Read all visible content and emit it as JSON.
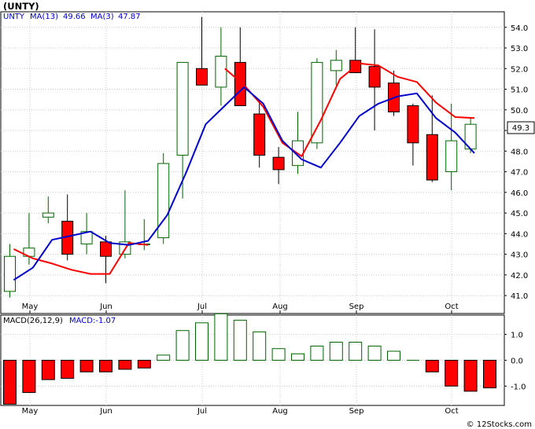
{
  "header": {
    "title": "(UNTY)",
    "legend_prefix": "UNTY",
    "ma13_label": "MA(13)",
    "ma13_value": "49.66",
    "ma3_label": "MA(3)",
    "ma3_value": "47.87",
    "last_price_badge": "49.3",
    "macd_label": "MACD(26,12,9)",
    "macd_value_label": "MACD:-1.07",
    "watermark": "© 12Stocks.com"
  },
  "colors": {
    "up": "#006400",
    "down": "#ff0000",
    "ma13": "#ff0000",
    "ma3": "#0000cc",
    "grid": "#c8c8c8",
    "legend_text": "#0000cc"
  },
  "chart_data": [
    {
      "type": "candlestick",
      "title": "(UNTY)",
      "x_labels": [
        "May",
        "Jun",
        "Jul",
        "Aug",
        "Sep",
        "Oct"
      ],
      "ylim": [
        40.7,
        54.6
      ],
      "y_ticks": [
        "41.0",
        "42.0",
        "43.0",
        "44.0",
        "45.0",
        "46.0",
        "47.0",
        "48.0",
        "49.0",
        "50.0",
        "51.0",
        "52.0",
        "53.0",
        "54.0"
      ],
      "grid": true,
      "candles": [
        {
          "o": 41.2,
          "h": 43.5,
          "l": 40.9,
          "c": 42.9
        },
        {
          "o": 42.9,
          "h": 45.0,
          "l": 42.5,
          "c": 43.3
        },
        {
          "o": 44.8,
          "h": 45.8,
          "l": 44.5,
          "c": 45.0
        },
        {
          "o": 44.6,
          "h": 45.9,
          "l": 42.7,
          "c": 43.0
        },
        {
          "o": 43.5,
          "h": 45.0,
          "l": 43.0,
          "c": 44.1
        },
        {
          "o": 43.6,
          "h": 43.9,
          "l": 41.6,
          "c": 42.9
        },
        {
          "o": 43.0,
          "h": 46.1,
          "l": 42.8,
          "c": 43.6
        },
        {
          "o": 43.5,
          "h": 44.7,
          "l": 43.2,
          "c": 43.5
        },
        {
          "o": 43.8,
          "h": 47.9,
          "l": 43.5,
          "c": 47.4
        },
        {
          "o": 47.8,
          "h": 52.3,
          "l": 45.7,
          "c": 52.3
        },
        {
          "o": 52.0,
          "h": 54.5,
          "l": 51.2,
          "c": 51.2
        },
        {
          "o": 51.1,
          "h": 54.0,
          "l": 50.2,
          "c": 52.6
        },
        {
          "o": 52.3,
          "h": 54.0,
          "l": 50.2,
          "c": 50.2
        },
        {
          "o": 49.8,
          "h": 50.4,
          "l": 47.2,
          "c": 47.8
        },
        {
          "o": 47.7,
          "h": 48.2,
          "l": 46.4,
          "c": 47.1
        },
        {
          "o": 47.3,
          "h": 49.9,
          "l": 46.9,
          "c": 48.5
        },
        {
          "o": 48.4,
          "h": 52.5,
          "l": 48.1,
          "c": 52.3
        },
        {
          "o": 51.9,
          "h": 52.9,
          "l": 51.2,
          "c": 52.4
        },
        {
          "o": 52.4,
          "h": 54.0,
          "l": 52.1,
          "c": 51.8
        },
        {
          "o": 52.1,
          "h": 53.9,
          "l": 49.0,
          "c": 51.1
        },
        {
          "o": 51.3,
          "h": 51.9,
          "l": 49.7,
          "c": 49.9
        },
        {
          "o": 50.2,
          "h": 50.3,
          "l": 47.3,
          "c": 48.4
        },
        {
          "o": 48.8,
          "h": 50.7,
          "l": 46.5,
          "c": 46.6
        },
        {
          "o": 47.0,
          "h": 50.3,
          "l": 46.1,
          "c": 48.5
        },
        {
          "o": 48.1,
          "h": 49.6,
          "l": 47.9,
          "c": 49.3
        }
      ],
      "ma13": [
        43.25,
        42.8,
        42.55,
        42.25,
        42.05,
        42.05,
        43.55,
        43.45,
        null,
        null,
        null,
        52.0,
        51.2,
        50.15,
        48.4,
        47.75,
        49.5,
        51.5,
        52.25,
        52.15,
        51.6,
        51.35,
        50.35,
        49.65,
        49.6
      ],
      "ma3": [
        41.75,
        42.35,
        43.7,
        43.9,
        44.1,
        43.55,
        43.45,
        43.65,
        44.9,
        47.0,
        49.3,
        50.2,
        51.1,
        50.3,
        48.5,
        47.6,
        47.2,
        48.4,
        49.7,
        50.3,
        50.65,
        50.8,
        49.6,
        48.9,
        47.9
      ],
      "ma_x_positions": [
        0.2,
        1.2,
        2.2,
        3.2,
        4.2,
        5.2,
        6.2,
        7.2,
        8.2,
        9.2,
        10.2,
        11.2,
        12.2,
        13.2,
        14.2,
        15.2,
        16.2,
        17.2,
        18.2,
        19.2,
        20.2,
        21.2,
        22.2,
        23.2,
        24.2
      ]
    },
    {
      "type": "bar",
      "title": "MACD(26,12,9)",
      "x_labels": [
        "May",
        "Jun",
        "Jul",
        "Aug",
        "Sep",
        "Oct"
      ],
      "ylim": [
        -1.75,
        1.75
      ],
      "y_ticks": [
        "1.0",
        "0.0",
        "-1.0"
      ],
      "values": [
        -1.7,
        -1.25,
        -0.75,
        -0.7,
        -0.45,
        -0.45,
        -0.35,
        -0.3,
        0.2,
        1.15,
        1.45,
        1.8,
        1.55,
        1.1,
        0.45,
        0.25,
        0.55,
        0.7,
        0.7,
        0.55,
        0.35,
        0.0,
        -0.45,
        -1.0,
        -1.2,
        -1.07
      ]
    }
  ]
}
